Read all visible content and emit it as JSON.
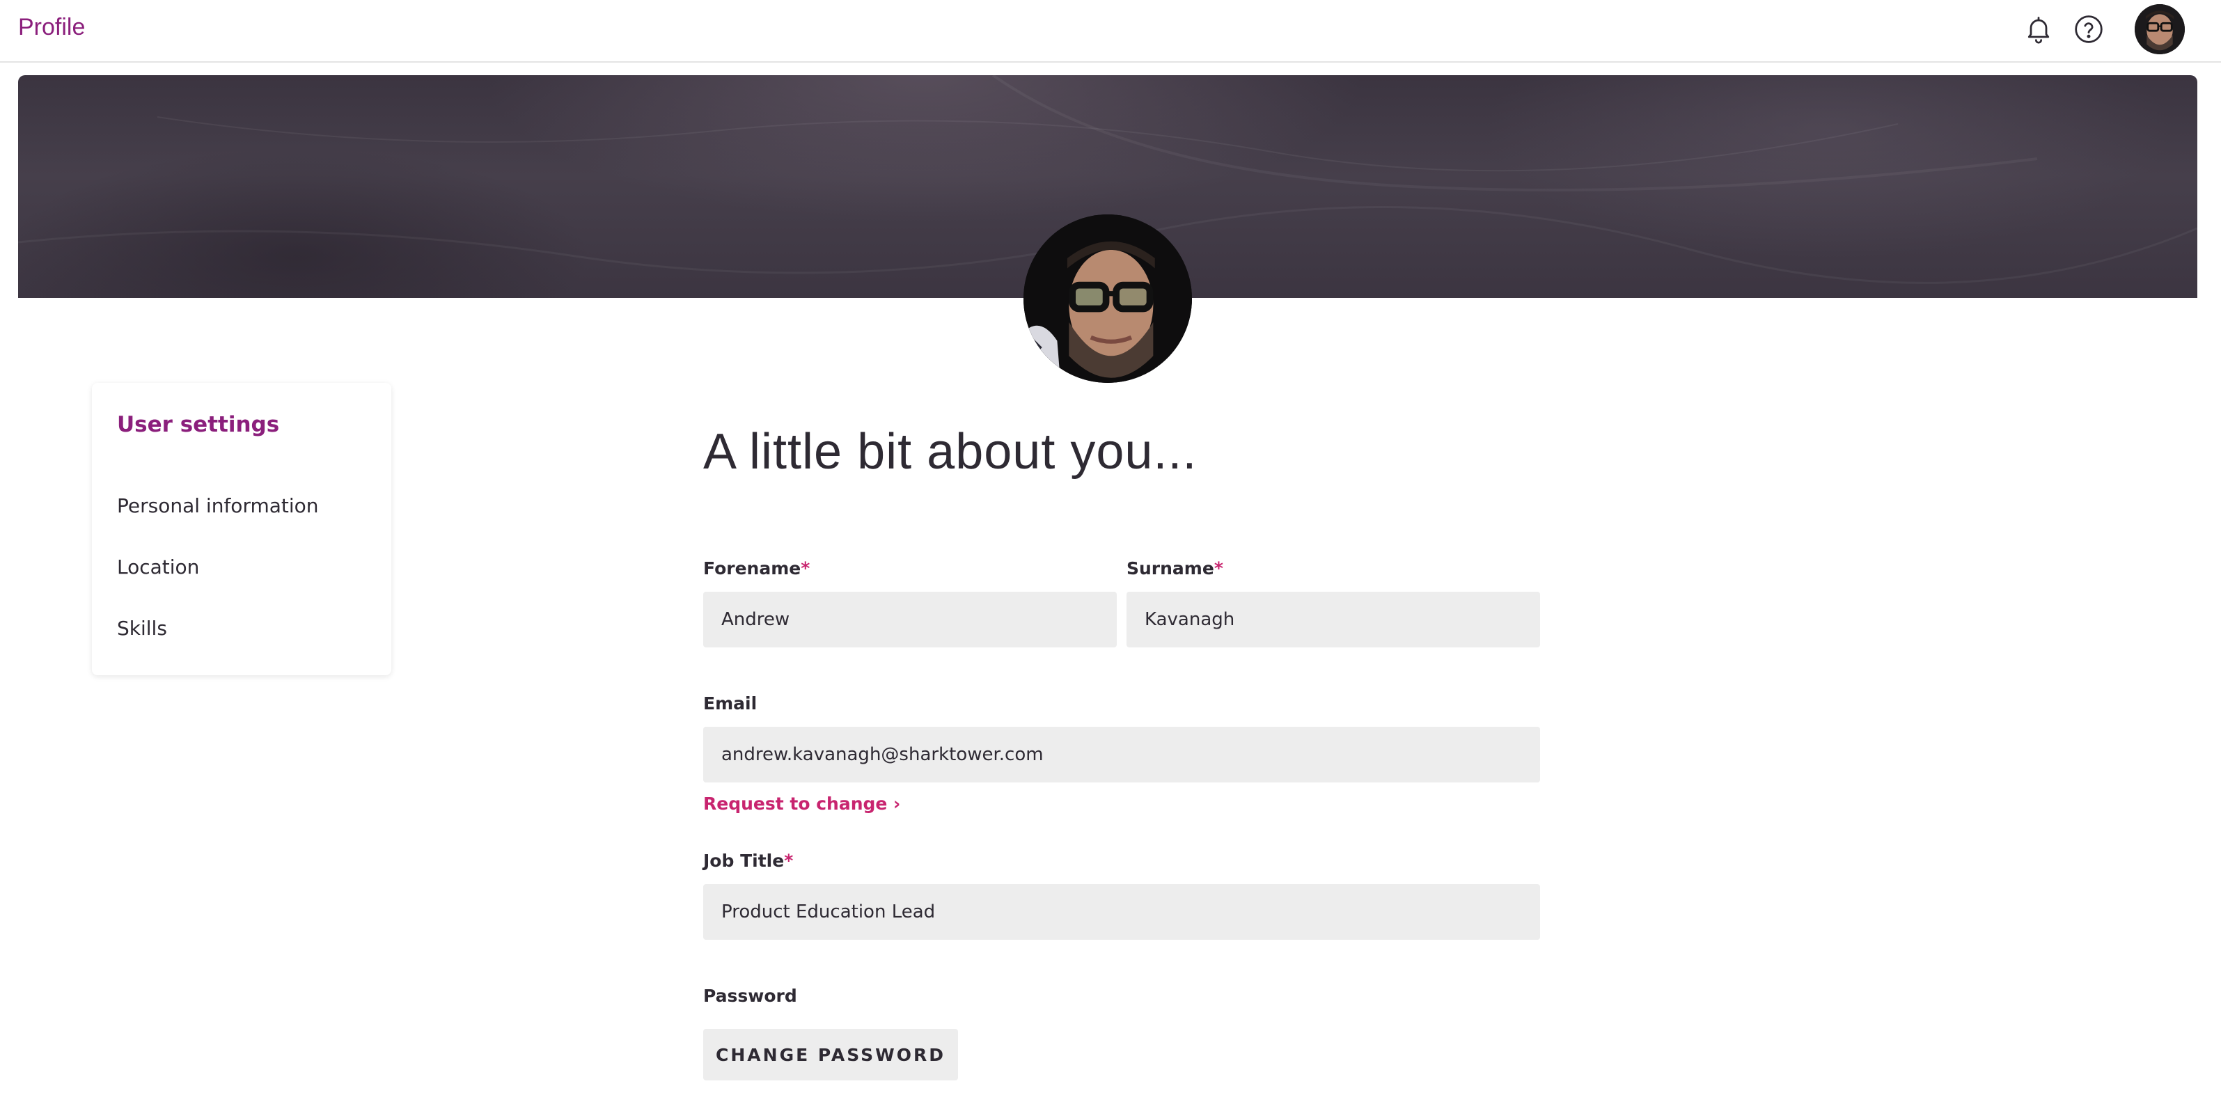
{
  "header": {
    "title": "Profile",
    "icons": [
      "bell-icon",
      "help-icon"
    ]
  },
  "sidebar": {
    "heading": "User settings",
    "items": [
      {
        "label": "Personal information"
      },
      {
        "label": "Location"
      },
      {
        "label": "Skills"
      }
    ]
  },
  "form": {
    "heading": "A little bit about you...",
    "required_marker": "*",
    "forename": {
      "label": "Forename",
      "value": "Andrew"
    },
    "surname": {
      "label": "Surname",
      "value": "Kavanagh"
    },
    "email": {
      "label": "Email",
      "value": "andrew.kavanagh@sharktower.com",
      "request_link": "Request to change ›"
    },
    "job_title": {
      "label": "Job Title",
      "value": "Product Education Lead"
    },
    "password": {
      "label": "Password",
      "button": "CHANGE PASSWORD"
    }
  },
  "colors": {
    "accent": "#8b1f7c",
    "link": "#c8246f",
    "input_bg": "#ededed",
    "banner": "#3f3844"
  }
}
